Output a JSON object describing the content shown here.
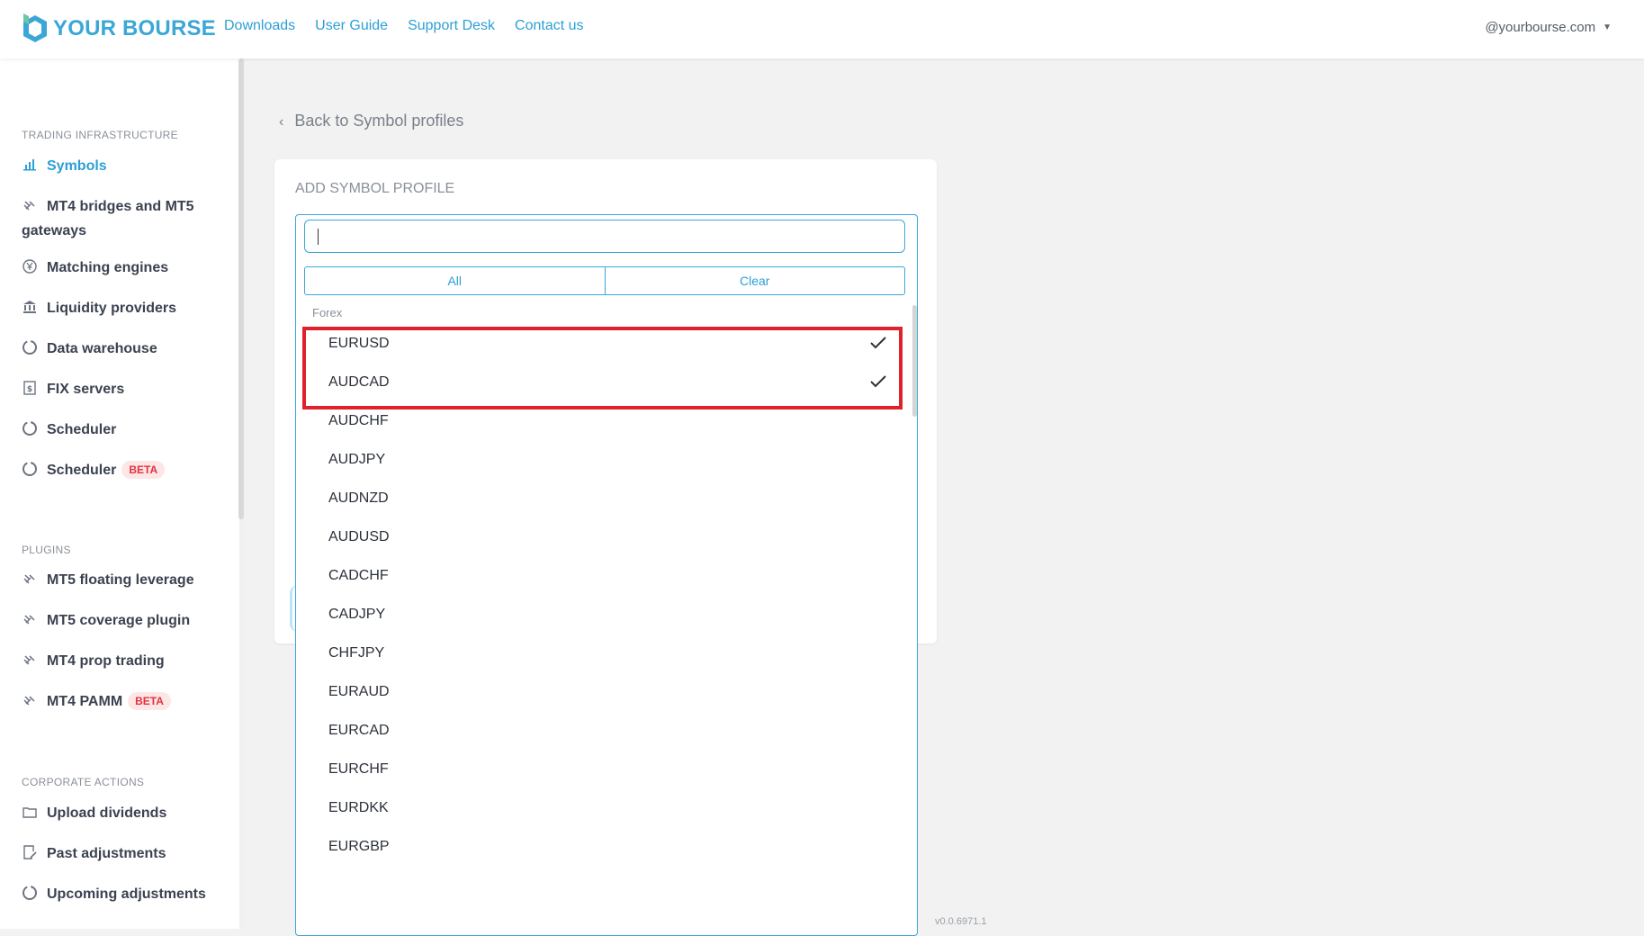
{
  "header": {
    "brand": "YOUR BOURSE",
    "nav": [
      "Downloads",
      "User Guide",
      "Support Desk",
      "Contact us"
    ],
    "account": "@yourbourse.com"
  },
  "sidebar": {
    "sections": [
      {
        "title": "TRADING INFRASTRUCTURE",
        "items": [
          {
            "label": "Symbols",
            "icon": "bar-chart-icon",
            "active": true
          },
          {
            "label": "MT4 bridges and MT5",
            "label2": "gateways",
            "icon": "plugin-icon"
          },
          {
            "label": "Matching engines",
            "icon": "yen-circle-icon"
          },
          {
            "label": "Liquidity providers",
            "icon": "bank-icon"
          },
          {
            "label": "Data warehouse",
            "icon": "circle-icon"
          },
          {
            "label": "FIX servers",
            "icon": "dollar-doc-icon"
          },
          {
            "label": "Scheduler",
            "icon": "circle-icon"
          },
          {
            "label": "Scheduler",
            "icon": "circle-icon",
            "badge": "BETA"
          }
        ]
      },
      {
        "title": "PLUGINS",
        "items": [
          {
            "label": "MT5 floating leverage",
            "icon": "plugin-icon"
          },
          {
            "label": "MT5 coverage plugin",
            "icon": "plugin-icon"
          },
          {
            "label": "MT4 prop trading",
            "icon": "plugin-icon"
          },
          {
            "label": "MT4 PAMM",
            "icon": "plugin-icon",
            "badge": "BETA"
          }
        ]
      },
      {
        "title": "CORPORATE ACTIONS",
        "items": [
          {
            "label": "Upload dividends",
            "icon": "folder-icon"
          },
          {
            "label": "Past adjustments",
            "icon": "edit-doc-icon"
          },
          {
            "label": "Upcoming adjustments",
            "icon": "circle-icon"
          }
        ]
      }
    ]
  },
  "main": {
    "back_label": "Back to Symbol profiles",
    "card_title": "ADD SYMBOL PROFILE",
    "dropdown": {
      "search_value": "",
      "all_label": "All",
      "clear_label": "Clear",
      "group": "Forex",
      "options": [
        {
          "label": "EURUSD",
          "selected": true
        },
        {
          "label": "AUDCAD",
          "selected": true
        },
        {
          "label": "AUDCHF",
          "selected": false
        },
        {
          "label": "AUDJPY",
          "selected": false
        },
        {
          "label": "AUDNZD",
          "selected": false
        },
        {
          "label": "AUDUSD",
          "selected": false
        },
        {
          "label": "CADCHF",
          "selected": false
        },
        {
          "label": "CADJPY",
          "selected": false
        },
        {
          "label": "CHFJPY",
          "selected": false
        },
        {
          "label": "EURAUD",
          "selected": false
        },
        {
          "label": "EURCAD",
          "selected": false
        },
        {
          "label": "EURCHF",
          "selected": false
        },
        {
          "label": "EURDKK",
          "selected": false
        },
        {
          "label": "EURGBP",
          "selected": false
        }
      ]
    },
    "version": "v0.0.6971.1"
  },
  "colors": {
    "accent": "#2d9fd6",
    "highlight": "#e0202a",
    "beta_text": "#e0333f",
    "beta_bg": "#fde6e6"
  }
}
